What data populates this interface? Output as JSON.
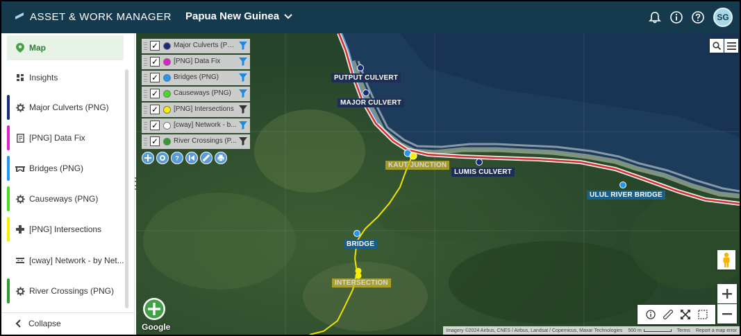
{
  "header": {
    "app_title": "ASSET & WORK MANAGER",
    "region": "Papua New Guinea",
    "avatar_initials": "SG",
    "bg_color": "#163a4d"
  },
  "sidebar": {
    "items": [
      {
        "label": "Map",
        "icon": "map-pin-icon",
        "color": "#2e7d32",
        "active": true
      },
      {
        "label": "Insights",
        "icon": "grid-icon",
        "color": ""
      },
      {
        "label": "Major Culverts (PNG)",
        "icon": "gear-icon",
        "color": "#1a2a7a"
      },
      {
        "label": "[PNG] Data Fix",
        "icon": "document-icon",
        "color": "#e020c8"
      },
      {
        "label": "Bridges (PNG)",
        "icon": "bridge-icon",
        "color": "#2196f3"
      },
      {
        "label": "Causeways (PNG)",
        "icon": "gear-icon",
        "color": "#44dd22"
      },
      {
        "label": "[PNG] Intersections",
        "icon": "plus-icon",
        "color": "#f5f000"
      },
      {
        "label": "[cway] Network - by Net...",
        "icon": "road-icon",
        "color": ""
      },
      {
        "label": "River Crossings (PNG)",
        "icon": "gear-icon",
        "color": "#2e9c2e"
      }
    ],
    "collapse_label": "Collapse"
  },
  "layers": [
    {
      "name": "Major Culverts (PNG...",
      "color": "#1a2a7a",
      "checked": true
    },
    {
      "name": "[PNG] Data Fix",
      "color": "#e020c8",
      "checked": true
    },
    {
      "name": "Bridges (PNG)",
      "color": "#2196f3",
      "checked": true
    },
    {
      "name": "Causeways (PNG)",
      "color": "#44dd22",
      "checked": true
    },
    {
      "name": "[PNG] Intersections",
      "color": "#f5f000",
      "checked": true
    },
    {
      "name": "[cway] Network - b...",
      "color": "#ffffff",
      "checked": true
    },
    {
      "name": "River Crossings (P...",
      "color": "#2e9c2e",
      "checked": true
    }
  ],
  "map_labels": {
    "putput": "PUTPUT CULVERT",
    "major": "MAJOR CULVERT",
    "kaut": "KAUT JUNCTION",
    "lumis": "LUMIS CULVERT",
    "ulul": "ULUL RIVER BRIDGE",
    "bridge": "BRIDGE",
    "intersection": "INTERSECTION"
  },
  "attribution": {
    "imagery": "Imagery ©2024 Airbus, CNES / Airbus, Landsat / Copernicus, Maxar Technologies",
    "scale": "500 m",
    "terms": "Terms",
    "report": "Report a map error",
    "google": "Google"
  }
}
